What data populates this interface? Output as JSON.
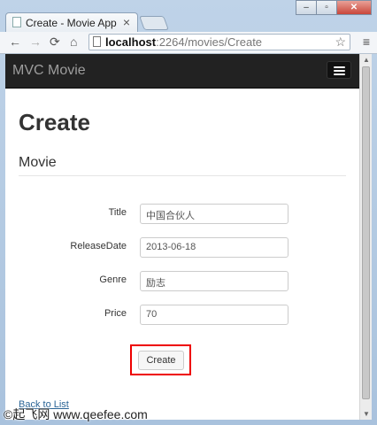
{
  "browser": {
    "tab_title": "Create - Movie App",
    "tab_close": "×",
    "url_host": "localhost",
    "url_rest": ":2264/movies/Create",
    "window_buttons": [
      "–",
      "▫",
      "✕"
    ],
    "icons": {
      "back": "back-arrow-icon",
      "forward": "forward-arrow-icon",
      "reload": "reload-icon",
      "home": "home-icon",
      "star": "star-icon",
      "menu": "menu-icon"
    }
  },
  "navbar": {
    "brand": "MVC Movie"
  },
  "page": {
    "heading": "Create",
    "subheading": "Movie",
    "fields": [
      {
        "label": "Title",
        "value": "中国合伙人"
      },
      {
        "label": "ReleaseDate",
        "value": "2013-06-18"
      },
      {
        "label": "Genre",
        "value": "励志"
      },
      {
        "label": "Price",
        "value": "70"
      }
    ],
    "create_button": "Create",
    "back_link": "Back to List"
  },
  "watermark": "©起飞网 www.qeefee.com",
  "colors": {
    "navbar_bg": "#222222",
    "brand": "#9d9d9d",
    "highlight": "#ee0000",
    "link": "#2a6496"
  }
}
